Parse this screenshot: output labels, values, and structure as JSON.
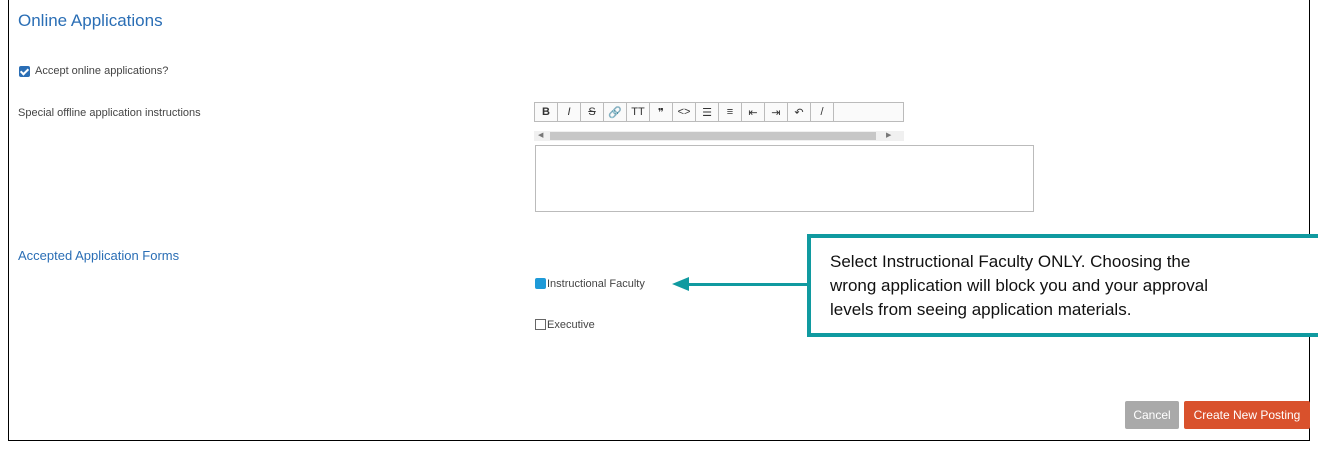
{
  "section_title": "Online Applications",
  "accept_online": {
    "label": "Accept online applications?",
    "checked": true
  },
  "offline_instructions": {
    "label": "Special offline application instructions",
    "value": ""
  },
  "toolbar": {
    "buttons": [
      {
        "icon": "bold-icon",
        "glyph": "B"
      },
      {
        "icon": "italic-icon",
        "glyph": "I"
      },
      {
        "icon": "strikethrough-icon",
        "glyph": "S"
      },
      {
        "icon": "link-icon",
        "glyph": "🔗"
      },
      {
        "icon": "heading-icon",
        "glyph": "TT"
      },
      {
        "icon": "quote-icon",
        "glyph": "❞"
      },
      {
        "icon": "code-icon",
        "glyph": "<>"
      },
      {
        "icon": "bullet-list-icon",
        "glyph": "☰"
      },
      {
        "icon": "numbered-list-icon",
        "glyph": "≡"
      },
      {
        "icon": "outdent-icon",
        "glyph": "⇤"
      },
      {
        "icon": "indent-icon",
        "glyph": "⇥"
      },
      {
        "icon": "undo-icon",
        "glyph": "↶"
      },
      {
        "icon": "redo-icon",
        "glyph": "/"
      }
    ]
  },
  "accepted_forms": {
    "title": "Accepted Application Forms",
    "options": [
      {
        "label": "Instructional Faculty",
        "checked": true
      },
      {
        "label": "Executive",
        "checked": false
      }
    ]
  },
  "callout": {
    "line1": "Select Instructional Faculty ONLY. Choosing the",
    "line2": "wrong application will block you and your approval",
    "line3": "levels from seeing application materials."
  },
  "buttons": {
    "cancel": "Cancel",
    "create": "Create New Posting"
  },
  "colors": {
    "accent": "#2a6eb5",
    "callout": "#109aa0",
    "create": "#d9512c",
    "cancel": "#a9a9a9"
  }
}
